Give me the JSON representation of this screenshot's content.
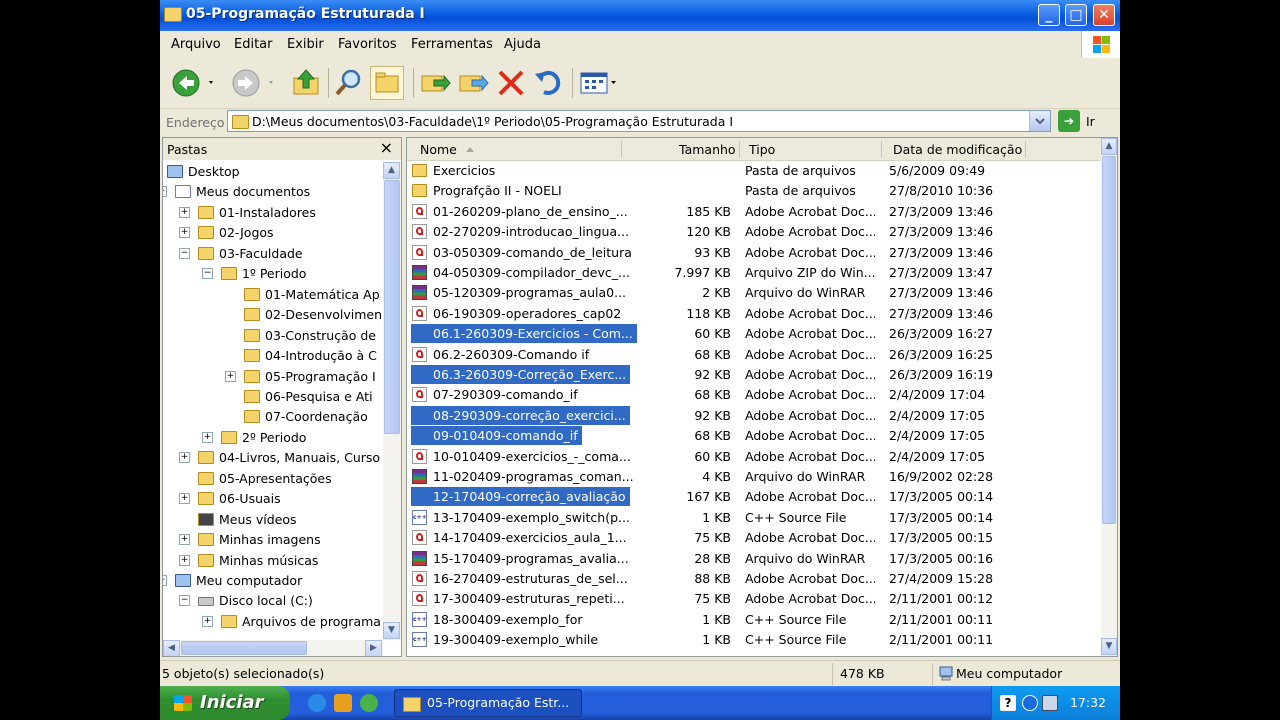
{
  "window": {
    "title": "05-Programação Estruturada I"
  },
  "menu": [
    "Arquivo",
    "Editar",
    "Exibir",
    "Favoritos",
    "Ferramentas",
    "Ajuda"
  ],
  "toolbar": {
    "icons": [
      "back-arrow-icon",
      "forward-arrow-icon",
      "up-folder-icon",
      "search-icon",
      "folders-icon",
      "move-to-icon",
      "copy-to-icon",
      "delete-icon",
      "undo-icon",
      "views-icon"
    ]
  },
  "address": {
    "label": "Endereço",
    "path": "D:\\Meus documentos\\03-Faculdade\\1º Periodo\\05-Programação Estruturada I",
    "go_label": "Ir"
  },
  "folders_pane": {
    "title": "Pastas",
    "close": "×",
    "tree": [
      {
        "label": "Desktop",
        "level": 0,
        "expander": "",
        "icon": "desktop-icon"
      },
      {
        "label": "Meus documentos",
        "level": 1,
        "expander": "−",
        "icon": "my-documents-icon"
      },
      {
        "label": "01-Instaladores",
        "level": 2,
        "expander": "+",
        "icon": "folder-icon"
      },
      {
        "label": "02-Jogos",
        "level": 2,
        "expander": "+",
        "icon": "folder-icon"
      },
      {
        "label": "03-Faculdade",
        "level": 2,
        "expander": "−",
        "icon": "folder-icon"
      },
      {
        "label": "1º Periodo",
        "level": 3,
        "expander": "−",
        "icon": "folder-icon"
      },
      {
        "label": "01-Matemática Ap",
        "level": 4,
        "expander": "",
        "icon": "folder-icon"
      },
      {
        "label": "02-Desenvolvimen",
        "level": 4,
        "expander": "",
        "icon": "folder-icon"
      },
      {
        "label": "03-Construção de",
        "level": 4,
        "expander": "",
        "icon": "folder-icon"
      },
      {
        "label": "04-Introdução à C",
        "level": 4,
        "expander": "",
        "icon": "folder-icon"
      },
      {
        "label": "05-Programação I",
        "level": 4,
        "expander": "+",
        "icon": "folder-open-icon"
      },
      {
        "label": "06-Pesquisa e Ati",
        "level": 4,
        "expander": "",
        "icon": "folder-icon"
      },
      {
        "label": "07-Coordenação",
        "level": 4,
        "expander": "",
        "icon": "folder-icon"
      },
      {
        "label": "2º Periodo",
        "level": 3,
        "expander": "+",
        "icon": "folder-icon"
      },
      {
        "label": "04-Livros, Manuais, Curso",
        "level": 2,
        "expander": "+",
        "icon": "folder-icon"
      },
      {
        "label": "05-Apresentações",
        "level": 2,
        "expander": "",
        "icon": "folder-icon"
      },
      {
        "label": "06-Usuais",
        "level": 2,
        "expander": "+",
        "icon": "folder-icon"
      },
      {
        "label": "Meus vídeos",
        "level": 2,
        "expander": "",
        "icon": "my-videos-icon"
      },
      {
        "label": "Minhas imagens",
        "level": 2,
        "expander": "+",
        "icon": "my-pictures-icon"
      },
      {
        "label": "Minhas músicas",
        "level": 2,
        "expander": "+",
        "icon": "my-music-icon"
      },
      {
        "label": "Meu computador",
        "level": 1,
        "expander": "−",
        "icon": "my-computer-icon"
      },
      {
        "label": "Disco local (C:)",
        "level": 2,
        "expander": "−",
        "icon": "disk-drive-icon"
      },
      {
        "label": "Arquivos de programa",
        "level": 3,
        "expander": "+",
        "icon": "folder-icon"
      }
    ]
  },
  "list": {
    "columns": {
      "name": "Nome",
      "size": "Tamanho",
      "type": "Tipo",
      "date": "Data de modificação"
    },
    "rows": [
      {
        "name": "Exercicios",
        "size": "",
        "type": "Pasta de arquivos",
        "date": "5/6/2009 09:49",
        "icon": "folder",
        "selected": false
      },
      {
        "name": "Prografção II - NOELI",
        "size": "",
        "type": "Pasta de arquivos",
        "date": "27/8/2010 10:36",
        "icon": "folder",
        "selected": false
      },
      {
        "name": "01-260209-plano_de_ensino_...",
        "size": "185 KB",
        "type": "Adobe Acrobat Doc...",
        "date": "27/3/2009 13:46",
        "icon": "pdf",
        "selected": false
      },
      {
        "name": "02-270209-introducao_lingua...",
        "size": "120 KB",
        "type": "Adobe Acrobat Doc...",
        "date": "27/3/2009 13:46",
        "icon": "pdf",
        "selected": false
      },
      {
        "name": "03-050309-comando_de_leitura",
        "size": "93 KB",
        "type": "Adobe Acrobat Doc...",
        "date": "27/3/2009 13:46",
        "icon": "pdf",
        "selected": false
      },
      {
        "name": "04-050309-compilador_devc_...",
        "size": "7.997 KB",
        "type": "Arquivo ZIP do Win...",
        "date": "27/3/2009 13:47",
        "icon": "zip",
        "selected": false
      },
      {
        "name": "05-120309-programas_aula0...",
        "size": "2 KB",
        "type": "Arquivo do WinRAR",
        "date": "27/3/2009 13:46",
        "icon": "zip",
        "selected": false
      },
      {
        "name": "06-190309-operadores_cap02",
        "size": "118 KB",
        "type": "Adobe Acrobat Doc...",
        "date": "27/3/2009 13:46",
        "icon": "pdf",
        "selected": false
      },
      {
        "name": "06.1-260309-Exercicios - Com...",
        "size": "60 KB",
        "type": "Adobe Acrobat Doc...",
        "date": "26/3/2009 16:27",
        "icon": "pdf",
        "selected": true
      },
      {
        "name": "06.2-260309-Comando if",
        "size": "68 KB",
        "type": "Adobe Acrobat Doc...",
        "date": "26/3/2009 16:25",
        "icon": "pdf",
        "selected": false
      },
      {
        "name": "06.3-260309-Correção_Exerc...",
        "size": "92 KB",
        "type": "Adobe Acrobat Doc...",
        "date": "26/3/2009 16:19",
        "icon": "pdf",
        "selected": true
      },
      {
        "name": "07-290309-comando_if",
        "size": "68 KB",
        "type": "Adobe Acrobat Doc...",
        "date": "2/4/2009 17:04",
        "icon": "pdf",
        "selected": false
      },
      {
        "name": "08-290309-correção_exercici...",
        "size": "92 KB",
        "type": "Adobe Acrobat Doc...",
        "date": "2/4/2009 17:05",
        "icon": "pdf",
        "selected": true
      },
      {
        "name": "09-010409-comando_if",
        "size": "68 KB",
        "type": "Adobe Acrobat Doc...",
        "date": "2/4/2009 17:05",
        "icon": "pdf",
        "selected": true
      },
      {
        "name": "10-010409-exercicios_-_coma...",
        "size": "60 KB",
        "type": "Adobe Acrobat Doc...",
        "date": "2/4/2009 17:05",
        "icon": "pdf",
        "selected": false
      },
      {
        "name": "11-020409-programas_coman...",
        "size": "4 KB",
        "type": "Arquivo do WinRAR",
        "date": "16/9/2002 02:28",
        "icon": "zip",
        "selected": false
      },
      {
        "name": "12-170409-correção_avaliação",
        "size": "167 KB",
        "type": "Adobe Acrobat Doc...",
        "date": "17/3/2005 00:14",
        "icon": "pdf",
        "selected": true
      },
      {
        "name": "13-170409-exemplo_switch(p...",
        "size": "1 KB",
        "type": "C++ Source File",
        "date": "17/3/2005 00:14",
        "icon": "cpp",
        "selected": false
      },
      {
        "name": "14-170409-exercicios_aula_1...",
        "size": "75 KB",
        "type": "Adobe Acrobat Doc...",
        "date": "17/3/2005 00:15",
        "icon": "pdf",
        "selected": false
      },
      {
        "name": "15-170409-programas_avalia...",
        "size": "28 KB",
        "type": "Arquivo do WinRAR",
        "date": "17/3/2005 00:16",
        "icon": "zip",
        "selected": false
      },
      {
        "name": "16-270409-estruturas_de_sel...",
        "size": "88 KB",
        "type": "Adobe Acrobat Doc...",
        "date": "27/4/2009 15:28",
        "icon": "pdf",
        "selected": false
      },
      {
        "name": "17-300409-estruturas_repeti...",
        "size": "75 KB",
        "type": "Adobe Acrobat Doc...",
        "date": "2/11/2001 00:12",
        "icon": "pdf",
        "selected": false
      },
      {
        "name": "18-300409-exemplo_for",
        "size": "1 KB",
        "type": "C++ Source File",
        "date": "2/11/2001 00:11",
        "icon": "cpp",
        "selected": false
      },
      {
        "name": "19-300409-exemplo_while",
        "size": "1 KB",
        "type": "C++ Source File",
        "date": "2/11/2001 00:11",
        "icon": "cpp",
        "selected": false
      }
    ]
  },
  "status": {
    "selection": "5 objeto(s) selecionado(s)",
    "size": "478 KB",
    "location": "Meu computador"
  },
  "taskbar": {
    "start": "Iniciar",
    "item": "05-Programação Estr...",
    "clock": "17:32"
  },
  "colors": {
    "selection": "#316ac5",
    "title_blue": "#0a5ee0",
    "start_green": "#2f8f2f"
  }
}
